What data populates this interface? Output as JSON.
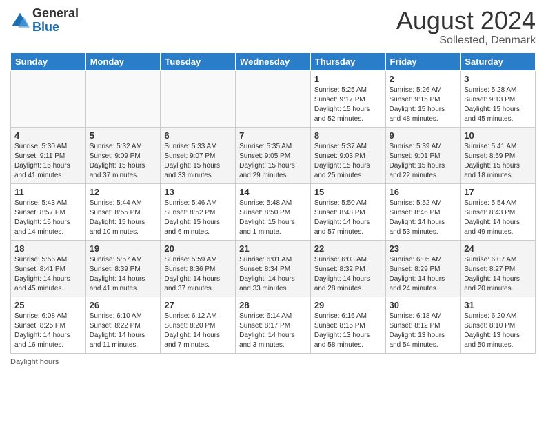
{
  "logo": {
    "general": "General",
    "blue": "Blue"
  },
  "title": "August 2024",
  "location": "Sollested, Denmark",
  "days_of_week": [
    "Sunday",
    "Monday",
    "Tuesday",
    "Wednesday",
    "Thursday",
    "Friday",
    "Saturday"
  ],
  "footer": "Daylight hours",
  "weeks": [
    [
      {
        "day": "",
        "info": ""
      },
      {
        "day": "",
        "info": ""
      },
      {
        "day": "",
        "info": ""
      },
      {
        "day": "",
        "info": ""
      },
      {
        "day": "1",
        "info": "Sunrise: 5:25 AM\nSunset: 9:17 PM\nDaylight: 15 hours\nand 52 minutes."
      },
      {
        "day": "2",
        "info": "Sunrise: 5:26 AM\nSunset: 9:15 PM\nDaylight: 15 hours\nand 48 minutes."
      },
      {
        "day": "3",
        "info": "Sunrise: 5:28 AM\nSunset: 9:13 PM\nDaylight: 15 hours\nand 45 minutes."
      }
    ],
    [
      {
        "day": "4",
        "info": "Sunrise: 5:30 AM\nSunset: 9:11 PM\nDaylight: 15 hours\nand 41 minutes."
      },
      {
        "day": "5",
        "info": "Sunrise: 5:32 AM\nSunset: 9:09 PM\nDaylight: 15 hours\nand 37 minutes."
      },
      {
        "day": "6",
        "info": "Sunrise: 5:33 AM\nSunset: 9:07 PM\nDaylight: 15 hours\nand 33 minutes."
      },
      {
        "day": "7",
        "info": "Sunrise: 5:35 AM\nSunset: 9:05 PM\nDaylight: 15 hours\nand 29 minutes."
      },
      {
        "day": "8",
        "info": "Sunrise: 5:37 AM\nSunset: 9:03 PM\nDaylight: 15 hours\nand 25 minutes."
      },
      {
        "day": "9",
        "info": "Sunrise: 5:39 AM\nSunset: 9:01 PM\nDaylight: 15 hours\nand 22 minutes."
      },
      {
        "day": "10",
        "info": "Sunrise: 5:41 AM\nSunset: 8:59 PM\nDaylight: 15 hours\nand 18 minutes."
      }
    ],
    [
      {
        "day": "11",
        "info": "Sunrise: 5:43 AM\nSunset: 8:57 PM\nDaylight: 15 hours\nand 14 minutes."
      },
      {
        "day": "12",
        "info": "Sunrise: 5:44 AM\nSunset: 8:55 PM\nDaylight: 15 hours\nand 10 minutes."
      },
      {
        "day": "13",
        "info": "Sunrise: 5:46 AM\nSunset: 8:52 PM\nDaylight: 15 hours\nand 6 minutes."
      },
      {
        "day": "14",
        "info": "Sunrise: 5:48 AM\nSunset: 8:50 PM\nDaylight: 15 hours\nand 1 minute."
      },
      {
        "day": "15",
        "info": "Sunrise: 5:50 AM\nSunset: 8:48 PM\nDaylight: 14 hours\nand 57 minutes."
      },
      {
        "day": "16",
        "info": "Sunrise: 5:52 AM\nSunset: 8:46 PM\nDaylight: 14 hours\nand 53 minutes."
      },
      {
        "day": "17",
        "info": "Sunrise: 5:54 AM\nSunset: 8:43 PM\nDaylight: 14 hours\nand 49 minutes."
      }
    ],
    [
      {
        "day": "18",
        "info": "Sunrise: 5:56 AM\nSunset: 8:41 PM\nDaylight: 14 hours\nand 45 minutes."
      },
      {
        "day": "19",
        "info": "Sunrise: 5:57 AM\nSunset: 8:39 PM\nDaylight: 14 hours\nand 41 minutes."
      },
      {
        "day": "20",
        "info": "Sunrise: 5:59 AM\nSunset: 8:36 PM\nDaylight: 14 hours\nand 37 minutes."
      },
      {
        "day": "21",
        "info": "Sunrise: 6:01 AM\nSunset: 8:34 PM\nDaylight: 14 hours\nand 33 minutes."
      },
      {
        "day": "22",
        "info": "Sunrise: 6:03 AM\nSunset: 8:32 PM\nDaylight: 14 hours\nand 28 minutes."
      },
      {
        "day": "23",
        "info": "Sunrise: 6:05 AM\nSunset: 8:29 PM\nDaylight: 14 hours\nand 24 minutes."
      },
      {
        "day": "24",
        "info": "Sunrise: 6:07 AM\nSunset: 8:27 PM\nDaylight: 14 hours\nand 20 minutes."
      }
    ],
    [
      {
        "day": "25",
        "info": "Sunrise: 6:08 AM\nSunset: 8:25 PM\nDaylight: 14 hours\nand 16 minutes."
      },
      {
        "day": "26",
        "info": "Sunrise: 6:10 AM\nSunset: 8:22 PM\nDaylight: 14 hours\nand 11 minutes."
      },
      {
        "day": "27",
        "info": "Sunrise: 6:12 AM\nSunset: 8:20 PM\nDaylight: 14 hours\nand 7 minutes."
      },
      {
        "day": "28",
        "info": "Sunrise: 6:14 AM\nSunset: 8:17 PM\nDaylight: 14 hours\nand 3 minutes."
      },
      {
        "day": "29",
        "info": "Sunrise: 6:16 AM\nSunset: 8:15 PM\nDaylight: 13 hours\nand 58 minutes."
      },
      {
        "day": "30",
        "info": "Sunrise: 6:18 AM\nSunset: 8:12 PM\nDaylight: 13 hours\nand 54 minutes."
      },
      {
        "day": "31",
        "info": "Sunrise: 6:20 AM\nSunset: 8:10 PM\nDaylight: 13 hours\nand 50 minutes."
      }
    ]
  ]
}
